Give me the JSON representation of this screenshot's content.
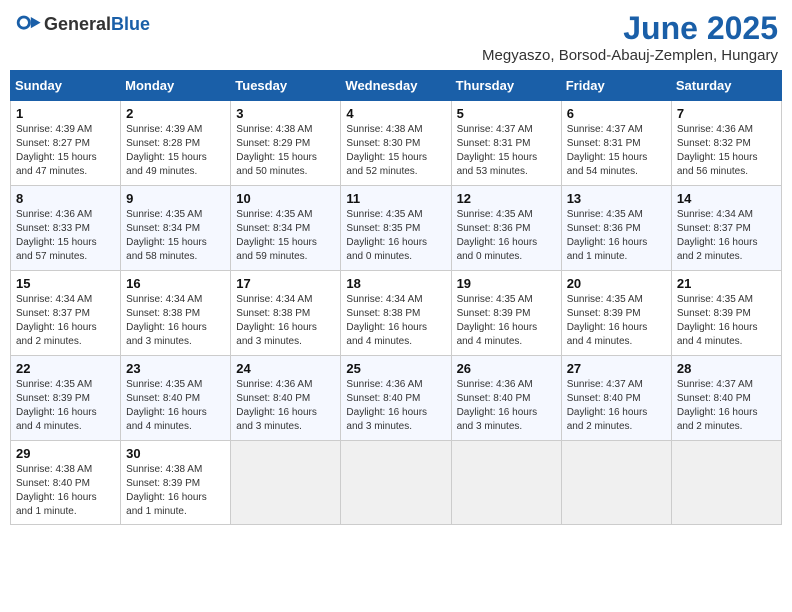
{
  "header": {
    "logo_general": "General",
    "logo_blue": "Blue",
    "month_year": "June 2025",
    "location": "Megyaszo, Borsod-Abauj-Zemplen, Hungary"
  },
  "weekdays": [
    "Sunday",
    "Monday",
    "Tuesday",
    "Wednesday",
    "Thursday",
    "Friday",
    "Saturday"
  ],
  "weeks": [
    [
      {
        "day": "1",
        "lines": [
          "Sunrise: 4:39 AM",
          "Sunset: 8:27 PM",
          "Daylight: 15 hours",
          "and 47 minutes."
        ]
      },
      {
        "day": "2",
        "lines": [
          "Sunrise: 4:39 AM",
          "Sunset: 8:28 PM",
          "Daylight: 15 hours",
          "and 49 minutes."
        ]
      },
      {
        "day": "3",
        "lines": [
          "Sunrise: 4:38 AM",
          "Sunset: 8:29 PM",
          "Daylight: 15 hours",
          "and 50 minutes."
        ]
      },
      {
        "day": "4",
        "lines": [
          "Sunrise: 4:38 AM",
          "Sunset: 8:30 PM",
          "Daylight: 15 hours",
          "and 52 minutes."
        ]
      },
      {
        "day": "5",
        "lines": [
          "Sunrise: 4:37 AM",
          "Sunset: 8:31 PM",
          "Daylight: 15 hours",
          "and 53 minutes."
        ]
      },
      {
        "day": "6",
        "lines": [
          "Sunrise: 4:37 AM",
          "Sunset: 8:31 PM",
          "Daylight: 15 hours",
          "and 54 minutes."
        ]
      },
      {
        "day": "7",
        "lines": [
          "Sunrise: 4:36 AM",
          "Sunset: 8:32 PM",
          "Daylight: 15 hours",
          "and 56 minutes."
        ]
      }
    ],
    [
      {
        "day": "8",
        "lines": [
          "Sunrise: 4:36 AM",
          "Sunset: 8:33 PM",
          "Daylight: 15 hours",
          "and 57 minutes."
        ]
      },
      {
        "day": "9",
        "lines": [
          "Sunrise: 4:35 AM",
          "Sunset: 8:34 PM",
          "Daylight: 15 hours",
          "and 58 minutes."
        ]
      },
      {
        "day": "10",
        "lines": [
          "Sunrise: 4:35 AM",
          "Sunset: 8:34 PM",
          "Daylight: 15 hours",
          "and 59 minutes."
        ]
      },
      {
        "day": "11",
        "lines": [
          "Sunrise: 4:35 AM",
          "Sunset: 8:35 PM",
          "Daylight: 16 hours",
          "and 0 minutes."
        ]
      },
      {
        "day": "12",
        "lines": [
          "Sunrise: 4:35 AM",
          "Sunset: 8:36 PM",
          "Daylight: 16 hours",
          "and 0 minutes."
        ]
      },
      {
        "day": "13",
        "lines": [
          "Sunrise: 4:35 AM",
          "Sunset: 8:36 PM",
          "Daylight: 16 hours",
          "and 1 minute."
        ]
      },
      {
        "day": "14",
        "lines": [
          "Sunrise: 4:34 AM",
          "Sunset: 8:37 PM",
          "Daylight: 16 hours",
          "and 2 minutes."
        ]
      }
    ],
    [
      {
        "day": "15",
        "lines": [
          "Sunrise: 4:34 AM",
          "Sunset: 8:37 PM",
          "Daylight: 16 hours",
          "and 2 minutes."
        ]
      },
      {
        "day": "16",
        "lines": [
          "Sunrise: 4:34 AM",
          "Sunset: 8:38 PM",
          "Daylight: 16 hours",
          "and 3 minutes."
        ]
      },
      {
        "day": "17",
        "lines": [
          "Sunrise: 4:34 AM",
          "Sunset: 8:38 PM",
          "Daylight: 16 hours",
          "and 3 minutes."
        ]
      },
      {
        "day": "18",
        "lines": [
          "Sunrise: 4:34 AM",
          "Sunset: 8:38 PM",
          "Daylight: 16 hours",
          "and 4 minutes."
        ]
      },
      {
        "day": "19",
        "lines": [
          "Sunrise: 4:35 AM",
          "Sunset: 8:39 PM",
          "Daylight: 16 hours",
          "and 4 minutes."
        ]
      },
      {
        "day": "20",
        "lines": [
          "Sunrise: 4:35 AM",
          "Sunset: 8:39 PM",
          "Daylight: 16 hours",
          "and 4 minutes."
        ]
      },
      {
        "day": "21",
        "lines": [
          "Sunrise: 4:35 AM",
          "Sunset: 8:39 PM",
          "Daylight: 16 hours",
          "and 4 minutes."
        ]
      }
    ],
    [
      {
        "day": "22",
        "lines": [
          "Sunrise: 4:35 AM",
          "Sunset: 8:39 PM",
          "Daylight: 16 hours",
          "and 4 minutes."
        ]
      },
      {
        "day": "23",
        "lines": [
          "Sunrise: 4:35 AM",
          "Sunset: 8:40 PM",
          "Daylight: 16 hours",
          "and 4 minutes."
        ]
      },
      {
        "day": "24",
        "lines": [
          "Sunrise: 4:36 AM",
          "Sunset: 8:40 PM",
          "Daylight: 16 hours",
          "and 3 minutes."
        ]
      },
      {
        "day": "25",
        "lines": [
          "Sunrise: 4:36 AM",
          "Sunset: 8:40 PM",
          "Daylight: 16 hours",
          "and 3 minutes."
        ]
      },
      {
        "day": "26",
        "lines": [
          "Sunrise: 4:36 AM",
          "Sunset: 8:40 PM",
          "Daylight: 16 hours",
          "and 3 minutes."
        ]
      },
      {
        "day": "27",
        "lines": [
          "Sunrise: 4:37 AM",
          "Sunset: 8:40 PM",
          "Daylight: 16 hours",
          "and 2 minutes."
        ]
      },
      {
        "day": "28",
        "lines": [
          "Sunrise: 4:37 AM",
          "Sunset: 8:40 PM",
          "Daylight: 16 hours",
          "and 2 minutes."
        ]
      }
    ],
    [
      {
        "day": "29",
        "lines": [
          "Sunrise: 4:38 AM",
          "Sunset: 8:40 PM",
          "Daylight: 16 hours",
          "and 1 minute."
        ]
      },
      {
        "day": "30",
        "lines": [
          "Sunrise: 4:38 AM",
          "Sunset: 8:39 PM",
          "Daylight: 16 hours",
          "and 1 minute."
        ]
      },
      null,
      null,
      null,
      null,
      null
    ]
  ]
}
